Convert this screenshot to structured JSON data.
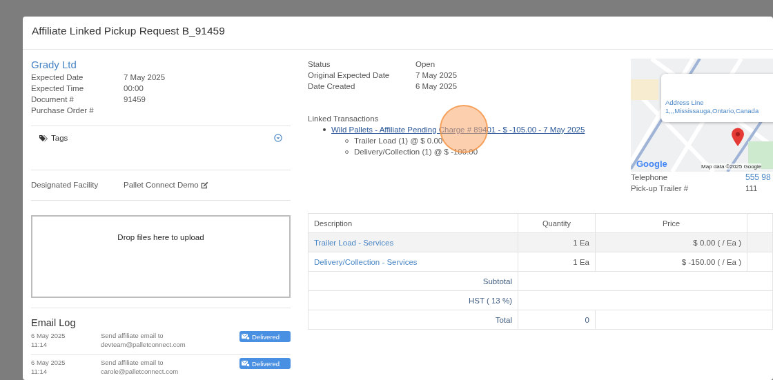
{
  "window": {
    "title": "Affiliate Linked Pickup Request B_91459"
  },
  "customer": {
    "name": "Grady Ltd",
    "fields": [
      {
        "label": "Expected Date",
        "value": "7 May 2025"
      },
      {
        "label": "Expected Time",
        "value": "00:00"
      },
      {
        "label": "Document #",
        "value": "91459"
      },
      {
        "label": "Purchase Order #"
      }
    ]
  },
  "tags": {
    "label": "Tags",
    "expanded": false
  },
  "facility": {
    "label": "Designated Facility",
    "value": "Pallet Connect Demo"
  },
  "upload": {
    "text": "Drop files here to upload"
  },
  "email_log": {
    "title": "Email Log",
    "entries": [
      {
        "date": "6 May 2025",
        "time": "11:14",
        "message": "Send affiliate email to",
        "recipient": "devteam@palletconnect.com",
        "status": "Delivered"
      },
      {
        "date": "6 May 2025",
        "time": "11:14",
        "message": "Send affiliate email to",
        "recipient": "carole@palletconnect.com",
        "status": "Delivered"
      }
    ]
  },
  "status_fields": [
    {
      "label": "Status",
      "value": "Open"
    },
    {
      "label": "Original Expected Date",
      "value": "7 May 2025"
    },
    {
      "label": "Date Created",
      "value": "6 May 2025"
    }
  ],
  "linked_transactions": {
    "title": "Linked Transactions",
    "items": [
      {
        "text": "Wild Pallets - Affiliate Pending Charge # 89401 - $ -105.00 - 7 May 2025",
        "children": [
          {
            "text": "Trailer Load (1) @ $ 0.00"
          },
          {
            "text": "Delivery/Collection (1) @ $ -100.00"
          }
        ]
      }
    ]
  },
  "map": {
    "address": "Address Line 1,,,Mississauga,Ontario,Canada",
    "logo": "Google",
    "attribution": "Map data ©2025 Google"
  },
  "contact_fields": [
    {
      "label": "Telephone",
      "value": "555 98",
      "kind": "link"
    },
    {
      "label": "Pick-up Trailer #",
      "value": "111",
      "kind": "text"
    }
  ],
  "table": {
    "columns": [
      "Description",
      "Quantity",
      "Price",
      ""
    ],
    "rows": [
      {
        "description": "Trailer Load - Services",
        "quantity": "1 Ea",
        "price": "$ 0.00 ( / Ea )",
        "highlighted": true
      },
      {
        "description": "Delivery/Collection - Services",
        "quantity": "1 Ea",
        "price": "$ -150.00 ( / Ea )",
        "highlighted": false
      }
    ],
    "totals": [
      {
        "label": "Subtotal"
      },
      {
        "label": "HST ( 13 %)"
      },
      {
        "label": "Total",
        "value": "0"
      }
    ]
  }
}
